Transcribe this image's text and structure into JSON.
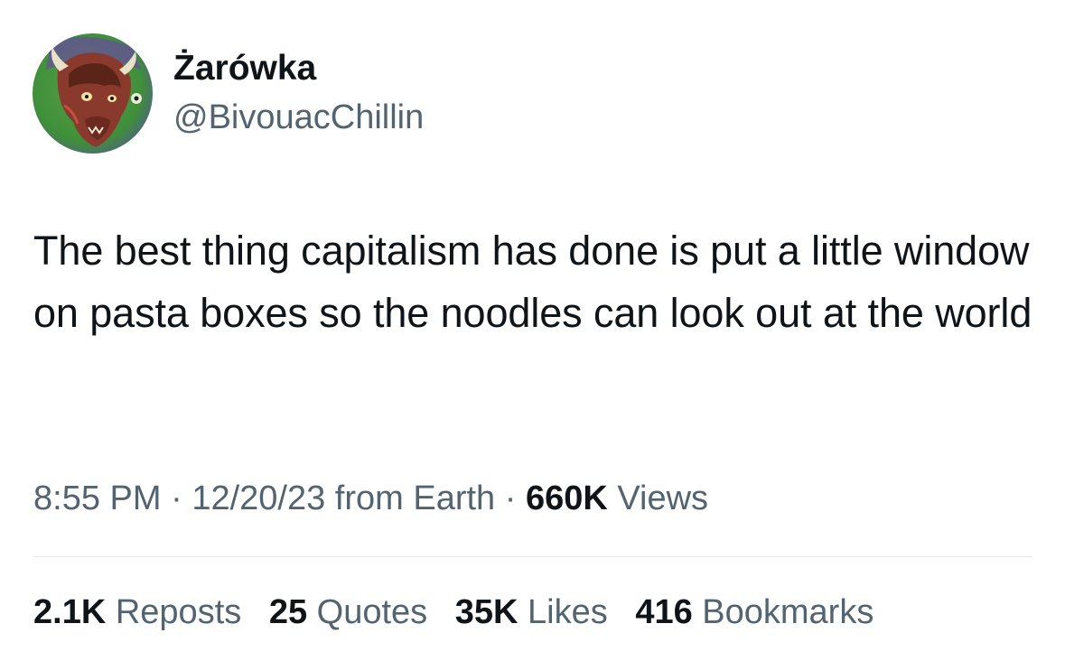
{
  "author": {
    "display_name": "Żarówka",
    "handle": "@BivouacChillin",
    "avatar_icon": "bison-avatar-icon"
  },
  "tweet": {
    "text": "The best thing capitalism has done is put a little window on pasta boxes so the noodles can look out at the world",
    "time": "8:55 PM",
    "date": "12/20/23",
    "source": "from Earth",
    "separator": "·",
    "views_count": "660K",
    "views_label": "Views"
  },
  "stats": {
    "reposts": {
      "count": "2.1K",
      "label": "Reposts"
    },
    "quotes": {
      "count": "25",
      "label": "Quotes"
    },
    "likes": {
      "count": "35K",
      "label": "Likes"
    },
    "bookmarks": {
      "count": "416",
      "label": "Bookmarks"
    }
  },
  "colors": {
    "text_primary": "#0f1419",
    "text_secondary": "#536471",
    "divider": "#e4e8eb",
    "avatar_bg_green": "#3a9a3a",
    "avatar_bg_purple": "#5a4aa8"
  }
}
